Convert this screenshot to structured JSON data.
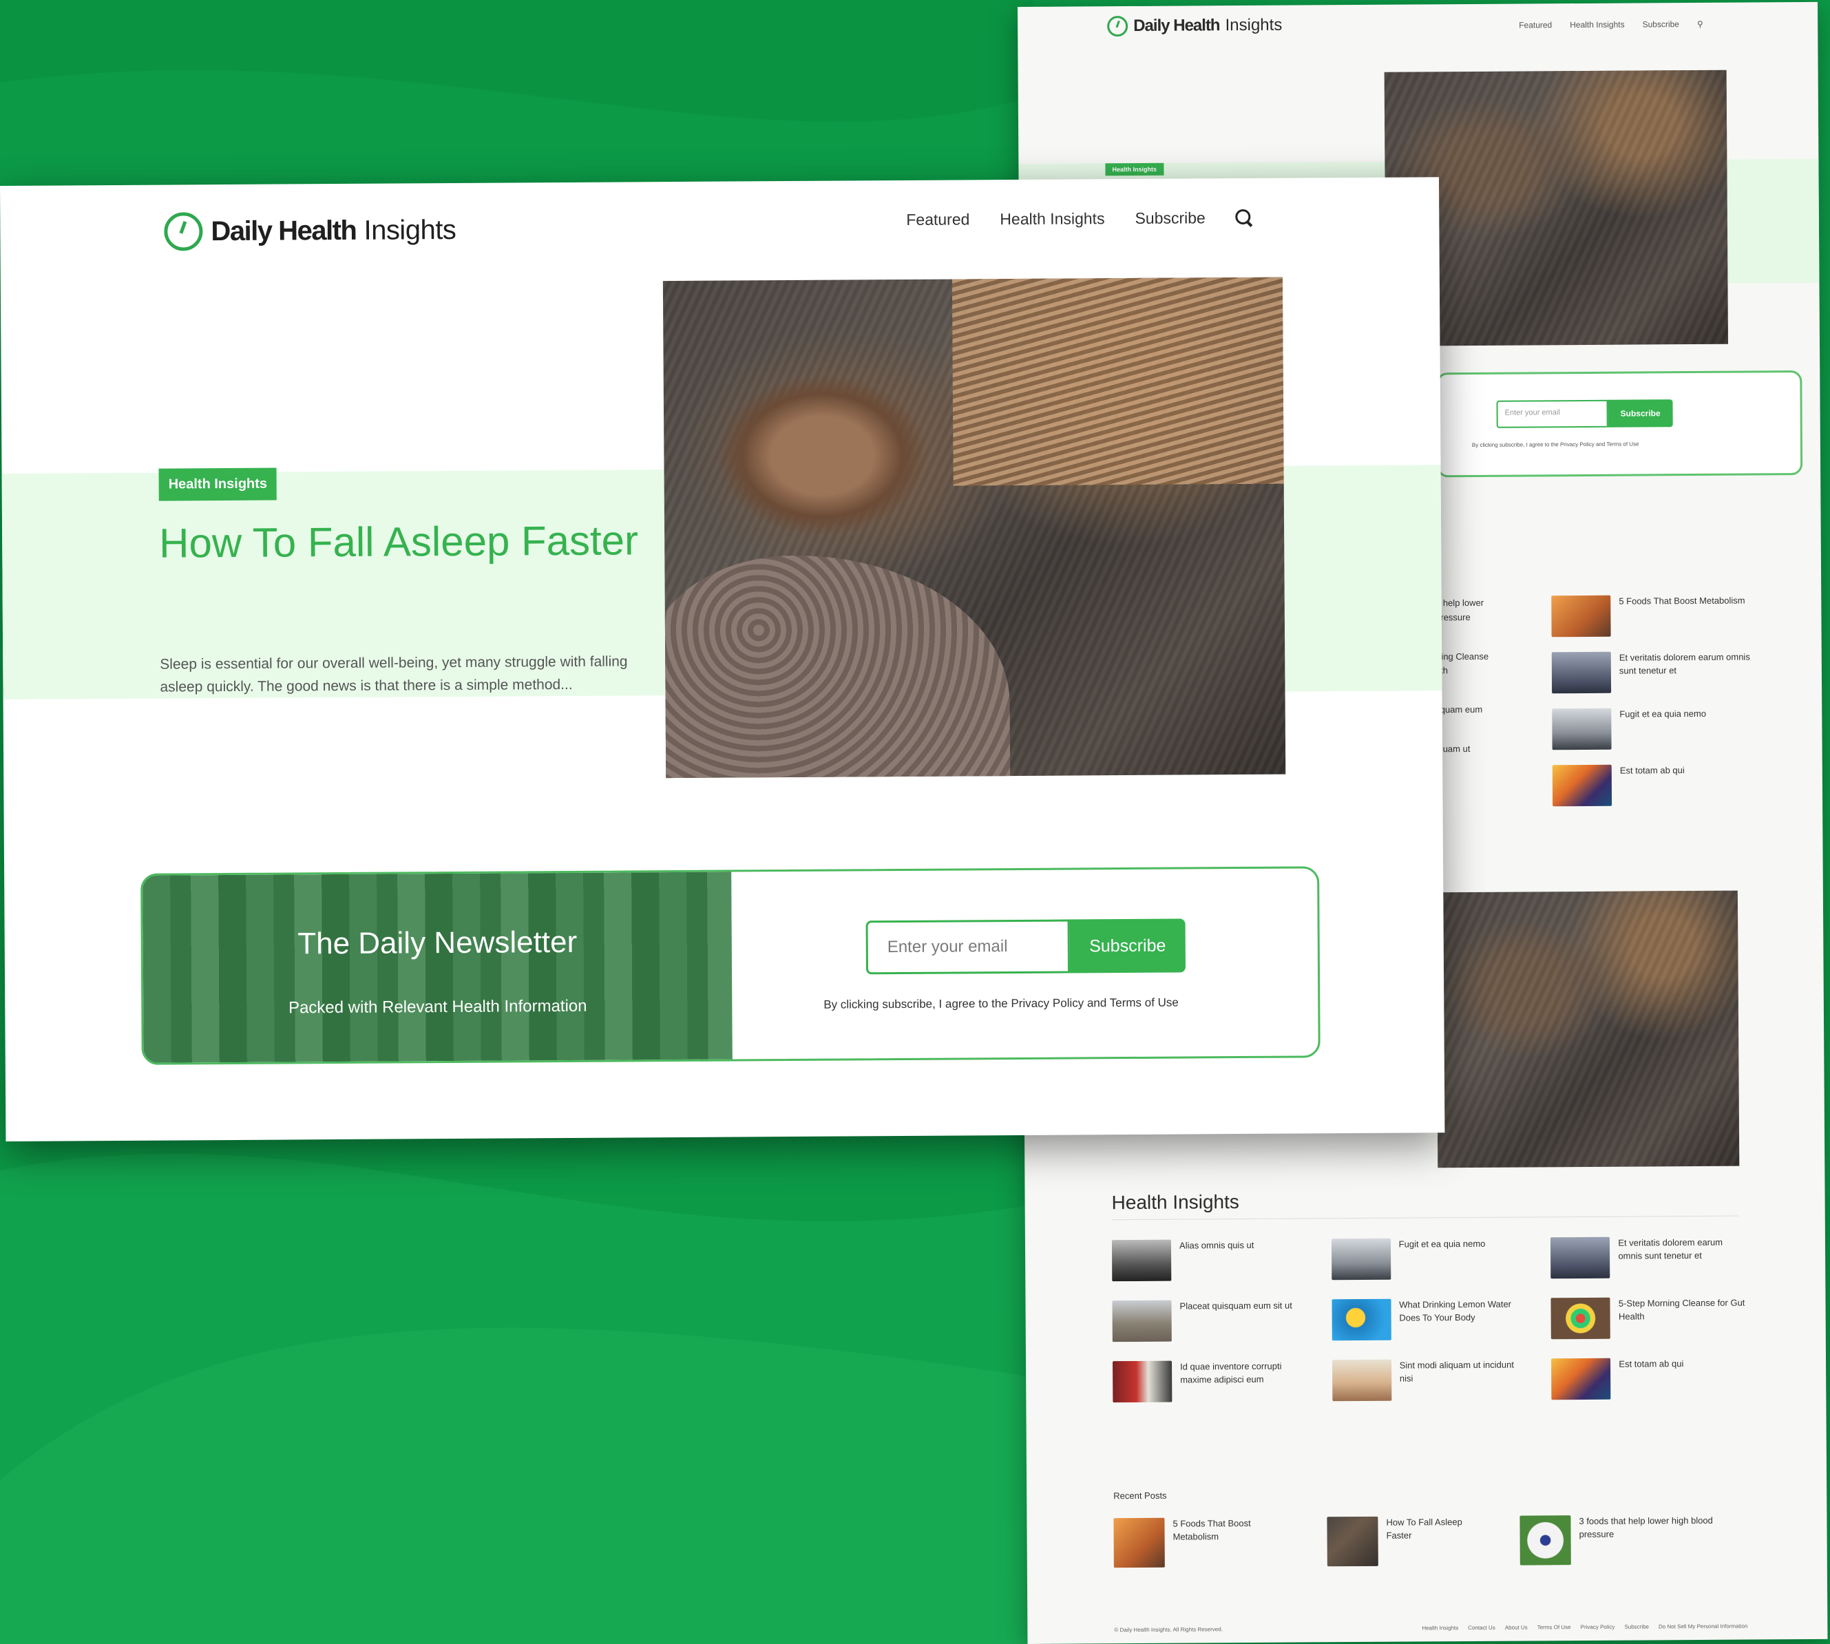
{
  "colors": {
    "brand_green": "#36b24f",
    "background_green": "#0c9a47",
    "light_band": "#e8fbe9"
  },
  "site": {
    "name_bold": "Daily Health",
    "name_light": "Insights",
    "logo_icon": "clock-icon"
  },
  "nav": {
    "items": [
      "Featured",
      "Health Insights",
      "Subscribe"
    ],
    "search_icon": "search-icon"
  },
  "hero": {
    "badge": "Health Insights",
    "title": "How To Fall Asleep Faster",
    "excerpt": "Sleep is essential for our overall well-being, yet many struggle with falling asleep quickly. The good news is that there is a simple method..."
  },
  "newsletter": {
    "title": "The Daily Newsletter",
    "subtitle": "Packed with Relevant Health Information",
    "email_placeholder": "Enter your email",
    "button": "Subscribe",
    "fine_print": "By clicking subscribe, I agree to the Privacy Policy and Terms of Use"
  },
  "back_page": {
    "featured_left": [
      "...hat help lower ...d pressure",
      "...orning Cleanse ...ealth",
      "...uisquam eum",
      "...aliquam ut ...nisi"
    ],
    "featured_right": [
      "5 Foods That Boost Metabolism",
      "Et veritatis dolorem earum omnis sunt tenetur et",
      "Fugit et ea quia nemo",
      "Est totam ab qui"
    ],
    "health_insights_title": "Health Insights",
    "health_insights": [
      "Alias omnis quis ut",
      "Fugit et ea quia nemo",
      "Et veritatis dolorem earum omnis sunt tenetur et",
      "Placeat quisquam eum sit ut",
      "What Drinking Lemon Water Does To Your Body",
      "5-Step Morning Cleanse for Gut Health",
      "Id quae inventore corrupti maxime adipisci eum",
      "Sint modi aliquam ut incidunt nisi",
      "Est totam ab qui"
    ],
    "recent_posts_title": "Recent Posts",
    "recent_posts": [
      "5 Foods That Boost Metabolism",
      "How To Fall Asleep Faster",
      "3 foods that help lower high blood pressure"
    ],
    "copyright": "© Daily Health Insights. All Rights Reserved.",
    "footer_links": [
      "Health Insights",
      "Contact Us",
      "About Us",
      "Terms Of Use",
      "Privacy Policy",
      "Subscribe",
      "Do Not Sell My Personal Information"
    ]
  }
}
